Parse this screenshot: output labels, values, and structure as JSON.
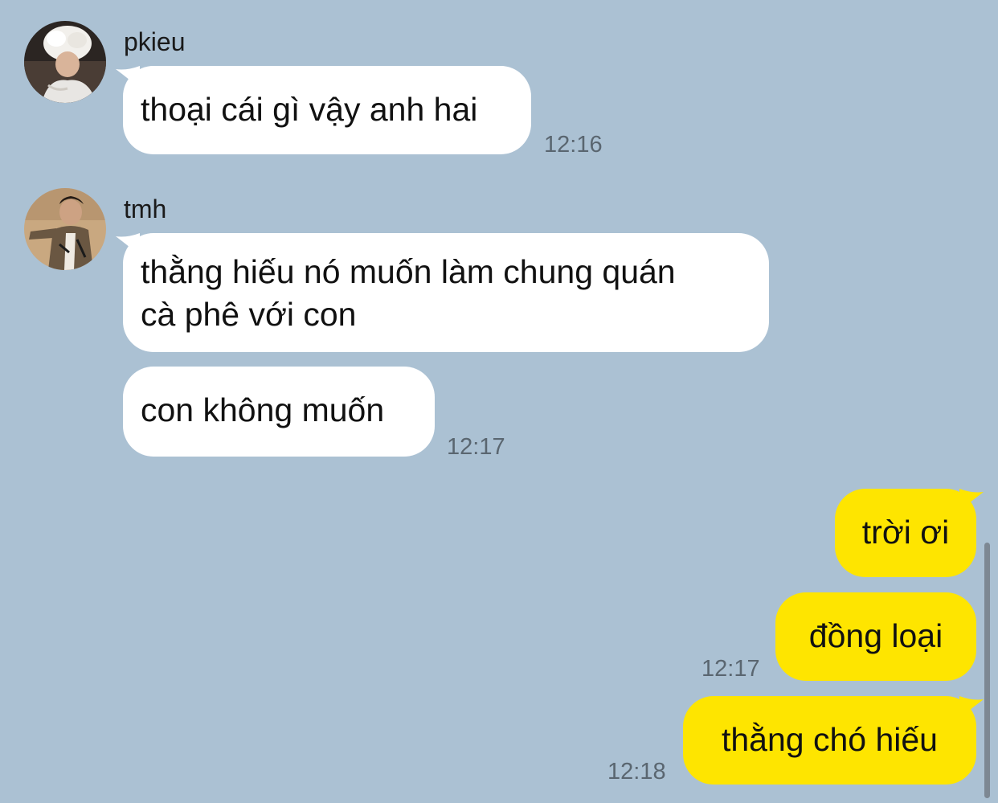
{
  "app": {
    "theme": "kakaotalk-style chat"
  },
  "colors": {
    "background": "#abc1d3",
    "incoming_bubble": "#ffffff",
    "outgoing_bubble": "#fee500",
    "timestamp": "#5a6670"
  },
  "messages": {
    "group1": {
      "sender": "pkieu",
      "avatar_icon": "user-avatar-fur-hat",
      "bubble1": "thoại cái gì vậy anh hai",
      "time": "12:16"
    },
    "group2": {
      "sender": "tmh",
      "avatar_icon": "user-avatar-portrait",
      "bubble1_line1": "thằng hiếu nó muốn làm chung quán",
      "bubble1_line2": "cà phê với con",
      "bubble2": "con không muốn",
      "time": "12:17"
    },
    "outgoing": {
      "bubble1": "trời ơi",
      "bubble2": "đồng loại",
      "time1": "12:17",
      "bubble3": "thằng chó hiếu",
      "time2": "12:18"
    }
  }
}
